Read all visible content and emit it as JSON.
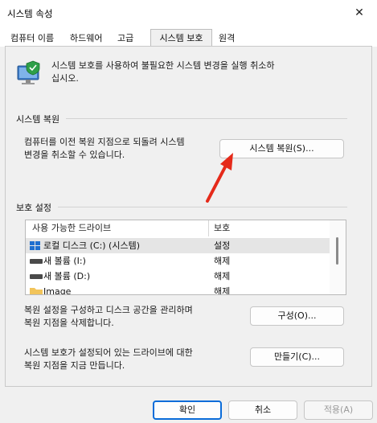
{
  "window": {
    "title": "시스템 속성",
    "close_glyph": "✕"
  },
  "tabs": [
    {
      "label": "컴퓨터 이름"
    },
    {
      "label": "하드웨어"
    },
    {
      "label": "고급"
    },
    {
      "label": "시스템 보호"
    },
    {
      "label": "원격"
    }
  ],
  "active_tab_index": 3,
  "intro": {
    "line1": "시스템 보호를 사용하여 불필요한 시스템 변경을 실행 취소하",
    "line2": "십시오."
  },
  "restore_section": {
    "label": "시스템 복원",
    "desc_line1": "컴퓨터를 이전 복원 지점으로 되돌려 시스템",
    "desc_line2": "변경을 취소할 수 있습니다.",
    "button_label": "시스템 복원(S)..."
  },
  "protection_section": {
    "label": "보호 설정",
    "columns": [
      "사용 가능한 드라이브",
      "보호"
    ],
    "rows": [
      {
        "drive": "로컬 디스크 (C:) (시스템)",
        "protection": "설정",
        "icon": "windows-drive-icon"
      },
      {
        "drive": "새 볼륨 (I:)",
        "protection": "해제",
        "icon": "drive-icon"
      },
      {
        "drive": "새 볼륨 (D:)",
        "protection": "해제",
        "icon": "drive-icon"
      },
      {
        "drive": "Image",
        "protection": "해제",
        "icon": "folder-icon"
      }
    ],
    "configure_desc_line1": "복원 설정을 구성하고 디스크 공간을 관리하며",
    "configure_desc_line2": "복원 지점을 삭제합니다.",
    "configure_button": "구성(O)...",
    "create_desc_line1": "시스템 보호가 설정되어 있는 드라이브에 대한",
    "create_desc_line2": "복원 지점을 지금 만듭니다.",
    "create_button": "만들기(C)..."
  },
  "footer": {
    "ok": "확인",
    "cancel": "취소",
    "apply": "적용(A)"
  },
  "colors": {
    "accent": "#0a6cd9",
    "annotation_arrow": "#e52a1a"
  }
}
